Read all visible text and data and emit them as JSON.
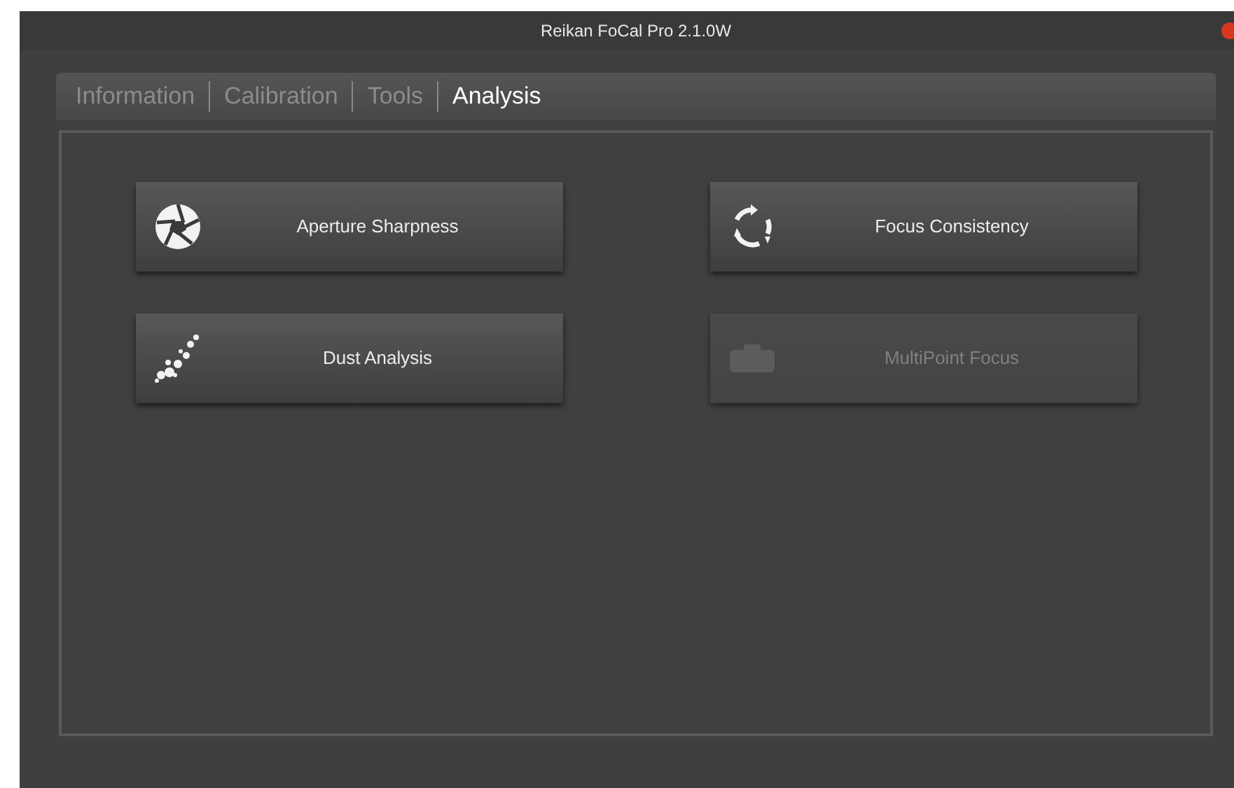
{
  "window": {
    "title": "Reikan FoCal Pro 2.1.0W"
  },
  "tabs": [
    {
      "label": "Information",
      "selected": false
    },
    {
      "label": "Calibration",
      "selected": false
    },
    {
      "label": "Tools",
      "selected": false
    },
    {
      "label": "Analysis",
      "selected": true
    }
  ],
  "buttons": [
    {
      "label": "Aperture Sharpness",
      "kind": "aperture",
      "disabled": false
    },
    {
      "label": "Focus Consistency",
      "kind": "cycle",
      "disabled": false
    },
    {
      "label": "Dust Analysis",
      "kind": "dust",
      "disabled": false
    },
    {
      "label": "MultiPoint Focus",
      "kind": "multipoint",
      "disabled": true
    }
  ]
}
